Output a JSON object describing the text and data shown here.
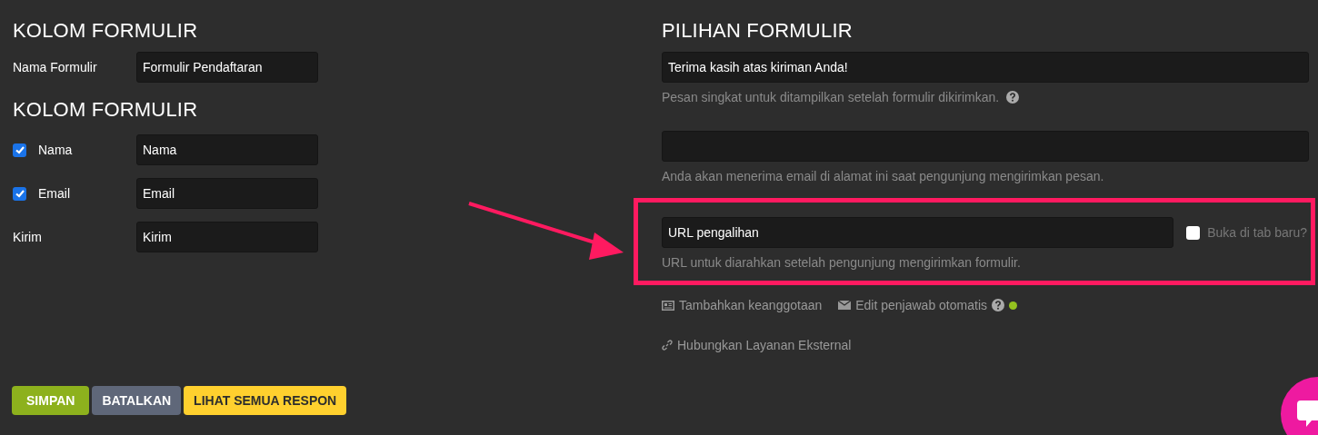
{
  "form_fields": {
    "title": "KOLOM FORMULIR",
    "form_name": {
      "label": "Nama Formulir",
      "value": "Formulir Pendaftaran"
    }
  },
  "fields_section": {
    "title": "KOLOM FORMULIR",
    "rows": [
      {
        "kind": "checkbox",
        "label": "Nama",
        "checked": true,
        "value": "Nama"
      },
      {
        "kind": "checkbox",
        "label": "Email",
        "checked": true,
        "value": "Email"
      },
      {
        "kind": "plain",
        "label": "Kirim",
        "value": "Kirim"
      }
    ]
  },
  "form_options": {
    "title": "PILIHAN FORMULIR",
    "thank_you": {
      "value": "Terima kasih atas kiriman Anda!",
      "hint": "Pesan singkat untuk ditampilkan setelah formulir dikirimkan."
    },
    "notify_email": {
      "hint": "Anda akan menerima email di alamat ini saat pengunjung mengirimkan pesan."
    },
    "redirect": {
      "value": "URL pengalihan",
      "new_tab_label": "Buka di tab baru?",
      "new_tab_checked": false,
      "hint": "URL untuk diarahkan setelah pengunjung mengirimkan formulir."
    },
    "links": [
      {
        "kind": "membership",
        "label": "Tambahkan keanggotaan"
      },
      {
        "kind": "autoresponder",
        "label": "Edit penjawab otomatis"
      },
      {
        "kind": "external",
        "label": "Hubungkan Layanan Eksternal"
      }
    ]
  },
  "buttons": [
    {
      "kind": "save",
      "label": "SIMPAN"
    },
    {
      "kind": "cancel",
      "label": "BATALKAN"
    },
    {
      "kind": "responses",
      "label": "LIHAT SEMUA RESPON"
    }
  ]
}
